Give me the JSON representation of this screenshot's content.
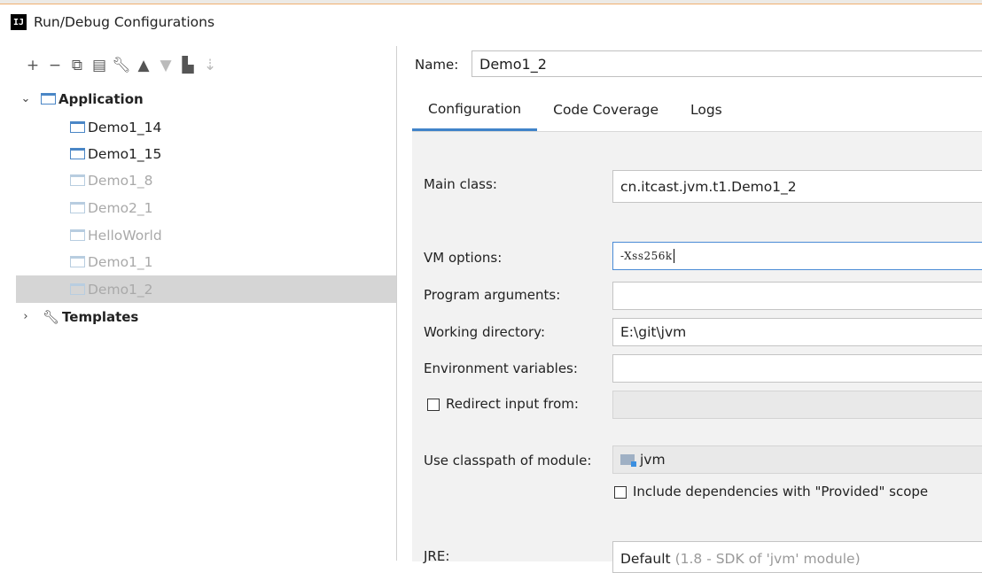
{
  "window": {
    "title": "Run/Debug Configurations",
    "app_icon": "IJ"
  },
  "colors": {
    "accent": "#4083c9",
    "selected_row": "#d5d5d5",
    "panel_bg": "#f2f2f2"
  },
  "toolbar": {
    "icons": [
      "add-icon",
      "remove-icon",
      "copy-icon",
      "save-icon",
      "wrench-icon",
      "move-up-icon",
      "move-down-icon",
      "folder-add-icon",
      "sort-icon"
    ]
  },
  "tree": {
    "application_label": "Application",
    "items": [
      {
        "label": "Demo1_14",
        "dim": false
      },
      {
        "label": "Demo1_15",
        "dim": false
      },
      {
        "label": "Demo1_8",
        "dim": true
      },
      {
        "label": "Demo2_1",
        "dim": true
      },
      {
        "label": "HelloWorld",
        "dim": true
      },
      {
        "label": "Demo1_1",
        "dim": true
      },
      {
        "label": "Demo1_2",
        "dim": true,
        "selected": true
      }
    ],
    "templates_label": "Templates"
  },
  "name": {
    "label": "Name:",
    "value": "Demo1_2"
  },
  "tabs": [
    {
      "label": "Configuration",
      "active": true
    },
    {
      "label": "Code Coverage",
      "active": false
    },
    {
      "label": "Logs",
      "active": false
    }
  ],
  "config": {
    "main_class_label": "Main class:",
    "main_class_value": "cn.itcast.jvm.t1.Demo1_2",
    "vm_options_label": "VM options:",
    "vm_options_value": "-Xss256k",
    "program_args_label": "Program arguments:",
    "program_args_value": "",
    "working_dir_label": "Working directory:",
    "working_dir_value": "E:\\git\\jvm",
    "env_vars_label": "Environment variables:",
    "env_vars_value": "",
    "redirect_label": "Redirect input from:",
    "redirect_checked": false,
    "classpath_label": "Use classpath of module:",
    "classpath_value": "jvm",
    "include_deps_label": "Include dependencies with \"Provided\" scope",
    "include_deps_checked": false,
    "jre_label": "JRE:",
    "jre_default": "Default",
    "jre_hint": "(1.8 - SDK of 'jvm' module)"
  }
}
